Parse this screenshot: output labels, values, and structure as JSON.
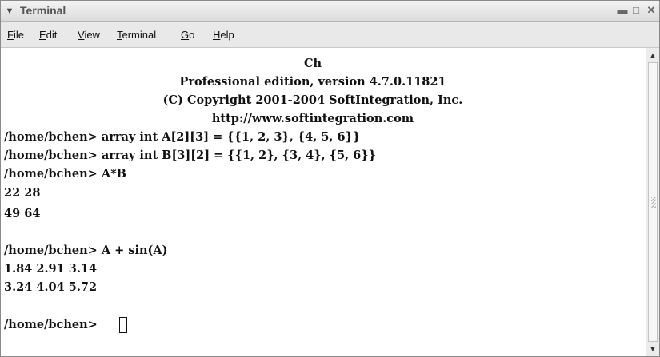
{
  "window": {
    "title": "Terminal",
    "menu_icon": "chevron-down-icon",
    "buttons": [
      "minimize-icon",
      "maximize-icon",
      "close-icon"
    ]
  },
  "menubar": {
    "items": [
      {
        "label_acc": "F",
        "label_rest": "ile"
      },
      {
        "label_acc": "E",
        "label_rest": "dit"
      },
      {
        "label_acc": "V",
        "label_rest": "iew"
      },
      {
        "label_acc": "T",
        "label_rest": "erminal"
      },
      {
        "label_acc": "G",
        "label_rest": "o"
      },
      {
        "label_acc": "H",
        "label_rest": "elp"
      }
    ]
  },
  "terminal": {
    "banner": [
      "Ch",
      "Professional edition, version 4.7.0.11821",
      "(C) Copyright 2001-2004 SoftIntegration, Inc.",
      "http://www.softintegration.com"
    ],
    "lines": [
      "/home/bchen> array int A[2][3] = {{1, 2, 3}, {4, 5, 6}}",
      "/home/bchen> array int B[3][2] = {{1, 2}, {3, 4}, {5, 6}}",
      "/home/bchen> A*B",
      "22 28",
      "49 64",
      "",
      "/home/bchen> A + sin(A)",
      "1.84 2.91 3.14",
      "3.24 4.04 5.72",
      "",
      "/home/bchen> "
    ]
  }
}
